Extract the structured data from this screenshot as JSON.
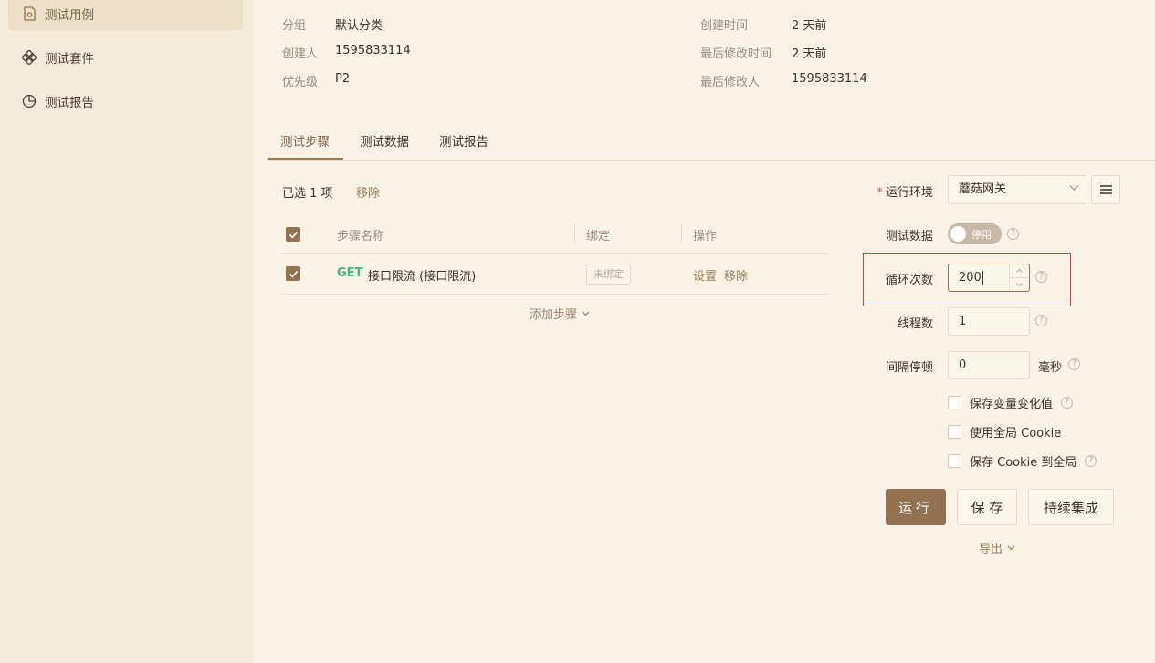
{
  "sidebar": {
    "items": [
      {
        "label": "测试用例",
        "icon": "document-icon",
        "active": true
      },
      {
        "label": "测试套件",
        "icon": "suite-icon",
        "active": false
      },
      {
        "label": "测试报告",
        "icon": "pie-chart-icon",
        "active": false
      }
    ]
  },
  "meta": {
    "group_label": "分组",
    "group_value": "默认分类",
    "creator_label": "创建人",
    "creator_value": "1595833114",
    "priority_label": "优先级",
    "priority_value": "P2",
    "created_label": "创建时间",
    "created_value": "2 天前",
    "modified_label": "最后修改时间",
    "modified_value": "2 天前",
    "modifier_label": "最后修改人",
    "modifier_value": "1595833114"
  },
  "tabs": [
    {
      "label": "测试步骤",
      "active": true
    },
    {
      "label": "测试数据",
      "active": false
    },
    {
      "label": "测试报告",
      "active": false
    }
  ],
  "steps": {
    "selected_text": "已选 1 项",
    "remove_label": "移除",
    "columns": [
      "步骤名称",
      "绑定",
      "操作"
    ],
    "rows": [
      {
        "method": "GET",
        "name": "接口限流 (接口限流)",
        "bind": "未绑定",
        "ops": [
          "设置",
          "移除"
        ],
        "checked": true
      }
    ],
    "add_step_label": "添加步骤"
  },
  "run_panel": {
    "env_label": "运行环境",
    "env_value": "蘑菇网关",
    "data_label": "测试数据",
    "data_toggle": "停用",
    "loop_label": "循环次数",
    "loop_value": "200",
    "threads_label": "线程数",
    "threads_value": "1",
    "interval_label": "间隔停顿",
    "interval_value": "0",
    "interval_unit": "毫秒",
    "options": [
      {
        "label": "保存变量变化值",
        "help": true
      },
      {
        "label": "使用全局 Cookie",
        "help": false
      },
      {
        "label": "保存 Cookie 到全局",
        "help": true
      }
    ],
    "run_label": "运行",
    "save_label": "保 存",
    "ci_label": "持续集成",
    "export_label": "导出"
  },
  "colors": {
    "accent": "#94714f",
    "background": "#f9f2e6",
    "sidebar": "#f4ecda",
    "get_method": "#41b883",
    "highlight": "#d9404a"
  }
}
